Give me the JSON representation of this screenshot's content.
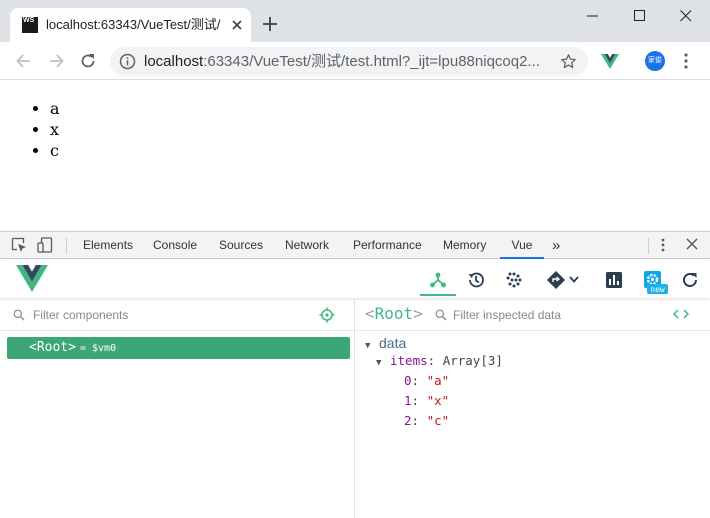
{
  "browser": {
    "tab_title": "localhost:63343/VueTest/测试/",
    "favicon_text_1": "WS",
    "url_host": "localhost",
    "url_rest": ":63343/VueTest/测试/test.html?_ijt=lpu88niqcoq2...",
    "avatar_text": "家俊"
  },
  "page": {
    "list_items": [
      "a",
      "x",
      "c"
    ]
  },
  "devtools": {
    "tabs": [
      "Elements",
      "Console",
      "Sources",
      "Network",
      "Performance",
      "Memory",
      "Vue"
    ],
    "active_tab": "Vue",
    "more_tabs": "»",
    "new_badge": "new"
  },
  "vue": {
    "filter_components_placeholder": "Filter components",
    "root_component": "<Root>",
    "root_vm": "= $vm0",
    "inspected_label_open": "<",
    "inspected_label_name": "Root",
    "inspected_label_close": ">",
    "filter_inspected_placeholder": "Filter inspected data",
    "section": "data",
    "prop_name": "items",
    "prop_value": "Array[3]",
    "array_items": [
      {
        "index": "0",
        "value": "\"a\""
      },
      {
        "index": "1",
        "value": "\"x\""
      },
      {
        "index": "2",
        "value": "\"c\""
      }
    ]
  },
  "colors": {
    "vue_green": "#41b883",
    "row_selected": "#3ba776",
    "chrome_blue": "#1a73e8"
  }
}
